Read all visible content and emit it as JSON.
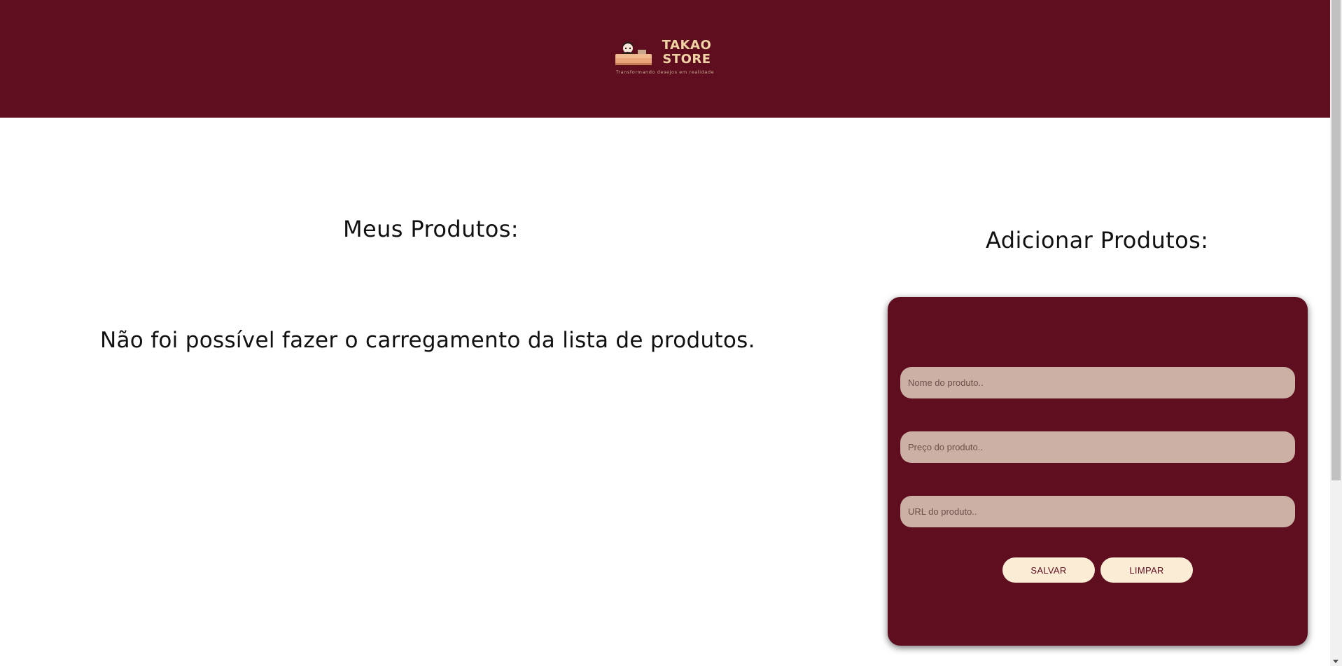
{
  "header": {
    "logo": {
      "line1": "TAKAO",
      "line2": "STORE",
      "tagline": "Transformando desejos em realidade",
      "icon": "store-logo-icon"
    }
  },
  "products": {
    "title": "Meus Produtos:",
    "error_message": "Não foi possível fazer o carregamento da lista de produtos."
  },
  "add_form": {
    "title": "Adicionar Produtos:",
    "name_placeholder": "Nome do produto..",
    "price_placeholder": "Preço do produto..",
    "url_placeholder": "URL do produto..",
    "save_label": "SALVAR",
    "clear_label": "LIMPAR"
  },
  "colors": {
    "brand": "#5e0e1f",
    "input_bg": "#ccb0a5",
    "button_bg": "#fbecd6",
    "logo_text": "#f0d3a5"
  }
}
